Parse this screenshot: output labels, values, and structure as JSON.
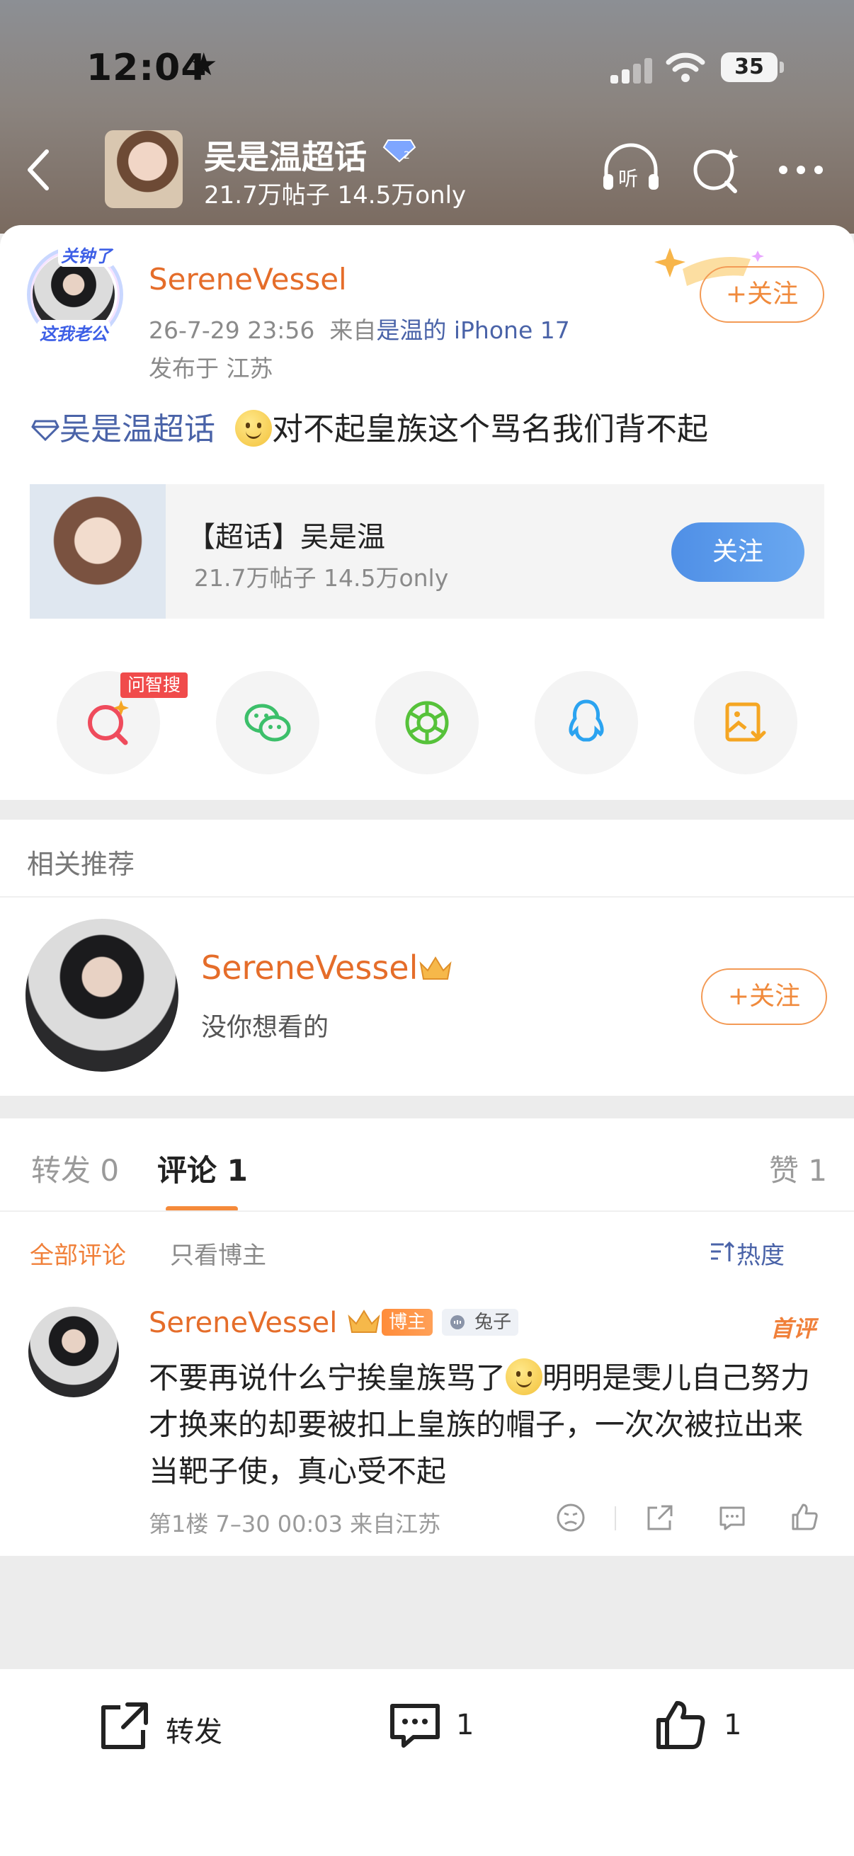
{
  "status": {
    "time": "12:04",
    "battery": "35"
  },
  "header": {
    "title": "吴是温超话",
    "subtitle": "21.7万帖子 14.5万only"
  },
  "post": {
    "avatar_tags": [
      "关钟了",
      "这我老公"
    ],
    "username": "SereneVessel",
    "follow_label": "+关注",
    "meta_time": "26-7-29 23:56",
    "meta_from": "来自",
    "meta_device": "是温的 iPhone 17",
    "meta_location": "发布于 江苏",
    "topic": "吴是温超话",
    "text": "对不起皇族这个骂名我们背不起"
  },
  "topic_card": {
    "name": "【超话】吴是温",
    "sub": "21.7万帖子 14.5万only",
    "follow_label": "关注"
  },
  "share": {
    "ask_badge": "问智搜"
  },
  "recommend": {
    "heading": "相关推荐",
    "username": "SereneVessel",
    "desc": "没你想看的",
    "follow_label": "+关注"
  },
  "tabs": {
    "repost": "转发 0",
    "comment": "评论 1",
    "like": "赞 1"
  },
  "filters": {
    "all": "全部评论",
    "author": "只看博主",
    "sort": "热度"
  },
  "comment": {
    "username": "SereneVessel",
    "tag_author": "博主",
    "tag_extra": "兔子",
    "first": "首评",
    "text_1": "不要再说什么宁挨皇族骂了",
    "text_2": "明明是雯儿自己努力才换来的却要被扣上皇族的帽子，一次次被拉出来当靶子使，真心受不起",
    "meta": "第1楼 7–30 00:03 来自江苏"
  },
  "bottom_bar": {
    "repost": "转发",
    "comment_count": "1",
    "like_count": "1"
  },
  "colors": {
    "accent_orange": "#e56d2a",
    "link_blue": "#4a63a8",
    "topic_button": "#5a9aea"
  }
}
